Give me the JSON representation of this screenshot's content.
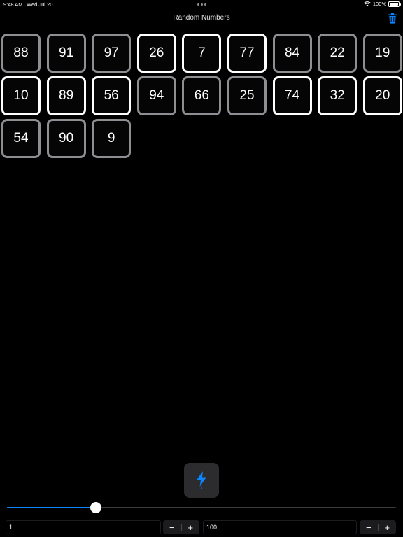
{
  "status_bar": {
    "time": "9:48 AM",
    "date": "Wed Jul 20",
    "battery": "100%"
  },
  "nav": {
    "title": "Random Numbers"
  },
  "tiles": [
    {
      "value": "88",
      "bright": false
    },
    {
      "value": "91",
      "bright": false
    },
    {
      "value": "97",
      "bright": false
    },
    {
      "value": "26",
      "bright": true
    },
    {
      "value": "7",
      "bright": true
    },
    {
      "value": "77",
      "bright": true
    },
    {
      "value": "84",
      "bright": false
    },
    {
      "value": "22",
      "bright": false
    },
    {
      "value": "19",
      "bright": false
    },
    {
      "value": "10",
      "bright": true
    },
    {
      "value": "89",
      "bright": true
    },
    {
      "value": "56",
      "bright": true
    },
    {
      "value": "94",
      "bright": false
    },
    {
      "value": "66",
      "bright": false
    },
    {
      "value": "25",
      "bright": false
    },
    {
      "value": "74",
      "bright": true
    },
    {
      "value": "32",
      "bright": true
    },
    {
      "value": "20",
      "bright": true
    },
    {
      "value": "54",
      "bright": false
    },
    {
      "value": "90",
      "bright": false
    },
    {
      "value": "9",
      "bright": false
    }
  ],
  "generate": {
    "count": "1"
  },
  "slider": {
    "fraction": 0.229
  },
  "range": {
    "min_value": "1",
    "max_value": "100",
    "decrement_label": "−",
    "increment_label": "+"
  },
  "colors": {
    "accent": "#0a84ff",
    "bright_border": "#ffffff",
    "dim_border": "#8e8e93"
  }
}
